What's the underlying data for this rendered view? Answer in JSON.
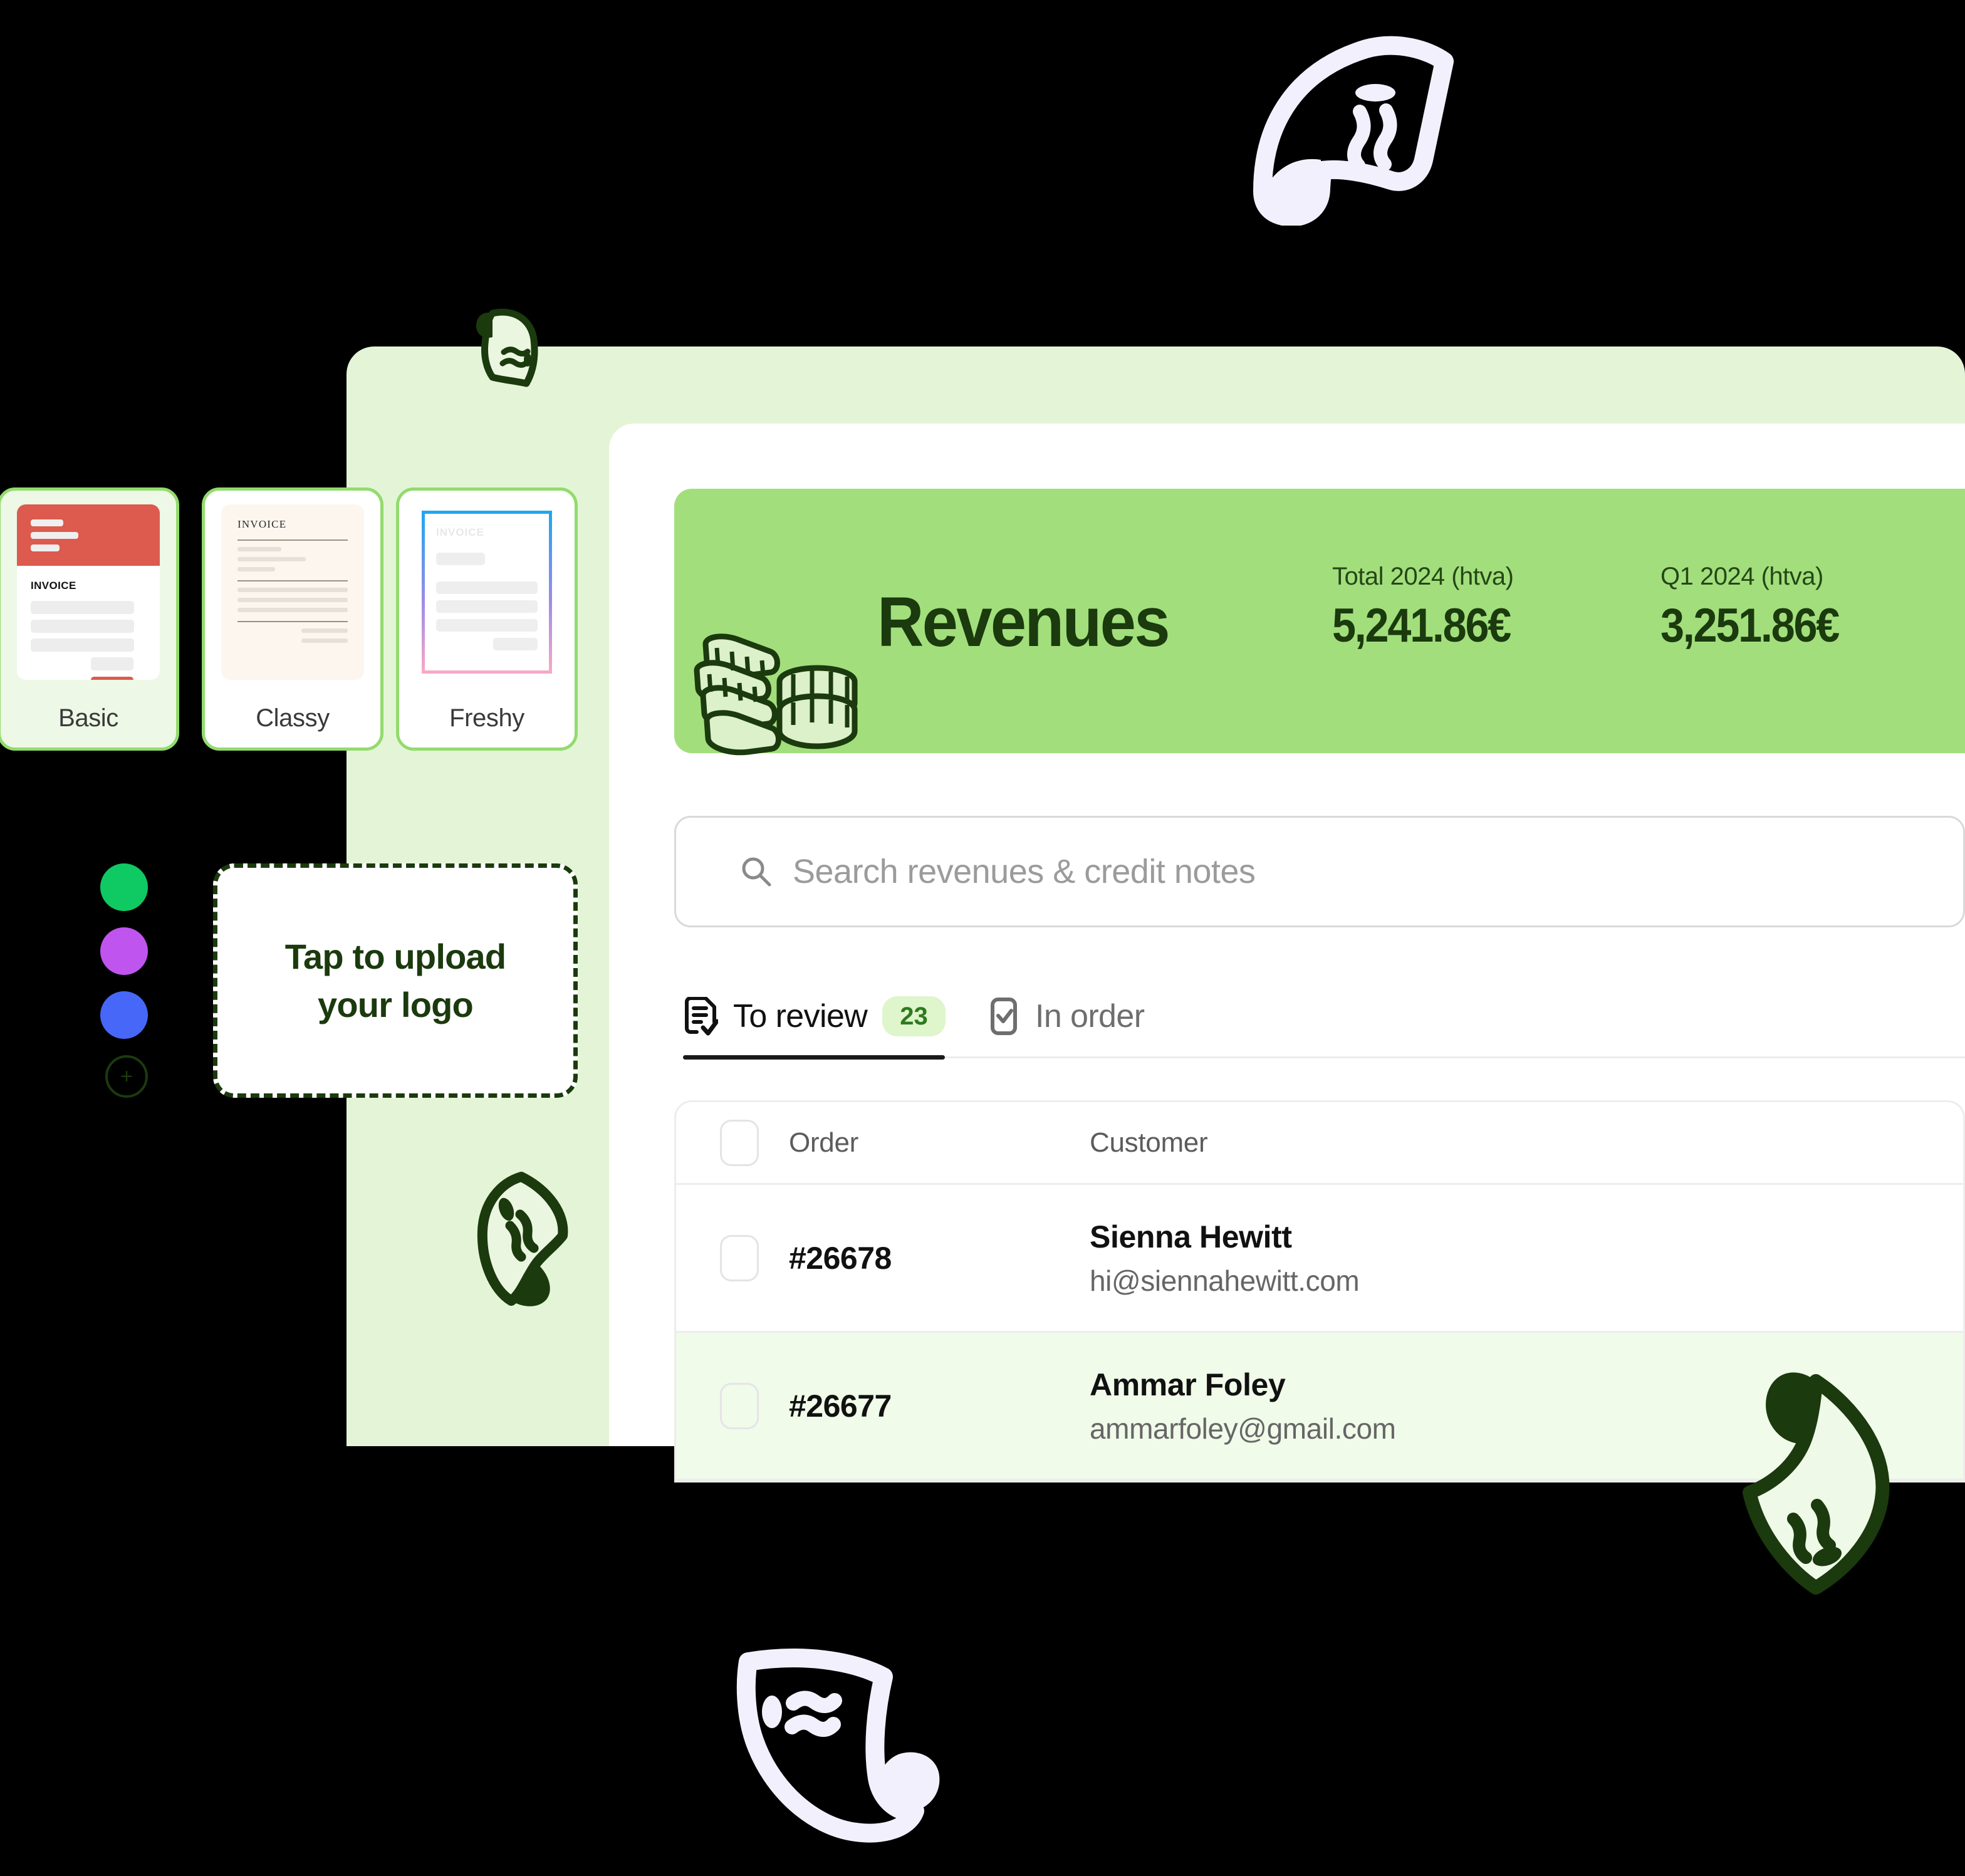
{
  "header": {
    "title": "Revenues",
    "stats": [
      {
        "label": "Total 2024 (htva)",
        "value": "5,241.86€"
      },
      {
        "label": "Q1 2024 (htva)",
        "value": "3,251.86€"
      }
    ],
    "bg_color": "#A2DF7C",
    "text_color": "#1B3A0E"
  },
  "search": {
    "placeholder": "Search revenues & credit notes",
    "value": "",
    "icon": "search-icon"
  },
  "tabs": [
    {
      "label": "To review",
      "icon": "document-check-icon",
      "badge": "23",
      "active": true
    },
    {
      "label": "In order",
      "icon": "checkbox-check-icon",
      "badge": "",
      "active": false
    }
  ],
  "table": {
    "columns": [
      "Order",
      "Customer"
    ],
    "rows": [
      {
        "order": "#26678",
        "customer_name": "Sienna Hewitt",
        "customer_email": "hi@siennahewitt.com",
        "highlighted": false
      },
      {
        "order": "#26677",
        "customer_name": "Ammar Foley",
        "customer_email": "ammarfoley@gmail.com",
        "highlighted": true
      }
    ]
  },
  "templates": {
    "cards": [
      {
        "name": "Basic",
        "selected": true,
        "accent": "#DC5A4E",
        "preview_title": "INVOICE"
      },
      {
        "name": "Classy",
        "selected": false,
        "accent": "#FCF6EE",
        "preview_title": "INVOICE"
      },
      {
        "name": "Freshy",
        "selected": false,
        "accent": "#1FA7F0",
        "preview_title": "INVOICE"
      }
    ]
  },
  "brand_colors": {
    "swatches": [
      "#0FC963",
      "#C054EE",
      "#4667F7"
    ],
    "add_label": "+"
  },
  "upload": {
    "line1": "Tap to upload",
    "line2": "your logo"
  },
  "palette": {
    "panel_green": "#E4F5D7",
    "header_green": "#A2DF7C",
    "row_highlight": "#F0FBE9",
    "dark_green": "#1B3A0E",
    "card_border": "#92DB6E"
  }
}
